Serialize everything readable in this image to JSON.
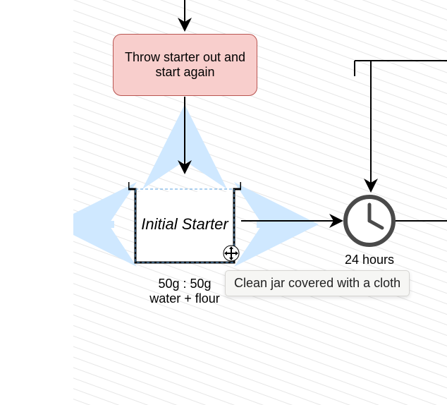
{
  "nodes": {
    "throw_out": "Throw starter out and start again",
    "initial_starter": "Initial Starter",
    "initial_caption": "50g : 50g\nwater + flour",
    "clock_caption": "24 hours"
  },
  "tooltip": "Clean jar covered with a cloth",
  "colors": {
    "process_bg": "#f8cecc",
    "process_border": "#b85450",
    "arrow_hint": "#cfe8ff",
    "clock_stroke": "#4a4a4a"
  }
}
